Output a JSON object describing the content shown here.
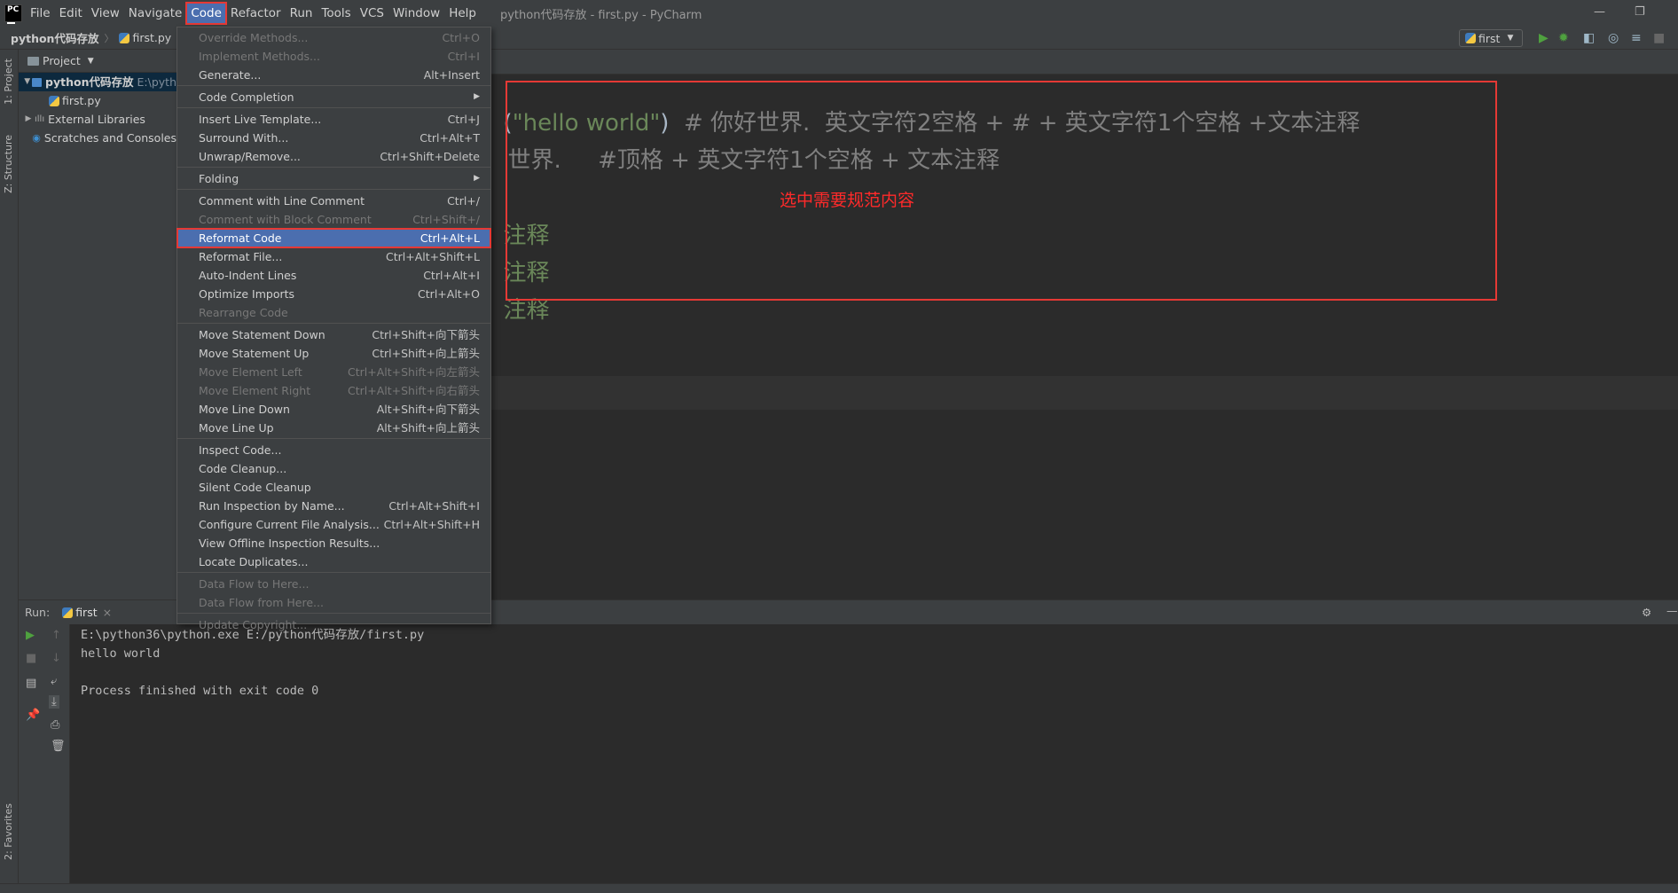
{
  "app": {
    "logo": "PC",
    "window_title": "python代码存放 - first.py - PyCharm"
  },
  "menubar": [
    "File",
    "Edit",
    "View",
    "Navigate",
    "Code",
    "Refactor",
    "Run",
    "Tools",
    "VCS",
    "Window",
    "Help"
  ],
  "menubar_active": "Code",
  "navbar": {
    "project": "python代码存放",
    "file": "first.py",
    "run_config": "first"
  },
  "left_strip": {
    "project_tab": "1: Project",
    "structure_tab": "Z: Structure",
    "favorites_tab": "2: Favorites"
  },
  "project_panel": {
    "title": "Project",
    "tree": [
      {
        "label": "python代码存放",
        "hint": "E:\\pyth",
        "type": "folder",
        "expanded": true,
        "selected": true
      },
      {
        "label": "first.py",
        "type": "python-file"
      },
      {
        "label": "External Libraries",
        "type": "library",
        "expanded": false
      },
      {
        "label": "Scratches and Consoles",
        "type": "scratch"
      }
    ]
  },
  "editor": {
    "line1_paren": "(",
    "line1_string": "\"hello world\"",
    "line1_close": ")",
    "line1_comment": "  # 你好世界.  英文字符2空格 + # + 英文字符1个空格 +文本注释",
    "line2": "世界.     #顶格 + 英文字符1个空格 + 文本注释",
    "line3": "注释",
    "line4": "注释",
    "line5": "注释",
    "annotation": "选中需要规范内容"
  },
  "code_menu": {
    "groups": [
      [
        {
          "label": "Override Methods...",
          "shortcut": "Ctrl+O",
          "disabled": true
        },
        {
          "label": "Implement Methods...",
          "shortcut": "Ctrl+I",
          "disabled": true
        },
        {
          "label": "Generate...",
          "shortcut": "Alt+Insert"
        }
      ],
      [
        {
          "label": "Code Completion",
          "shortcut": "",
          "submenu": true
        }
      ],
      [
        {
          "label": "Insert Live Template...",
          "shortcut": "Ctrl+J"
        },
        {
          "label": "Surround With...",
          "shortcut": "Ctrl+Alt+T"
        },
        {
          "label": "Unwrap/Remove...",
          "shortcut": "Ctrl+Shift+Delete"
        }
      ],
      [
        {
          "label": "Folding",
          "shortcut": "",
          "submenu": true
        }
      ],
      [
        {
          "label": "Comment with Line Comment",
          "shortcut": "Ctrl+/"
        },
        {
          "label": "Comment with Block Comment",
          "shortcut": "Ctrl+Shift+/",
          "disabled": true
        },
        {
          "label": "Reformat Code",
          "shortcut": "Ctrl+Alt+L",
          "highlight": true
        },
        {
          "label": "Reformat File...",
          "shortcut": "Ctrl+Alt+Shift+L"
        },
        {
          "label": "Auto-Indent Lines",
          "shortcut": "Ctrl+Alt+I"
        },
        {
          "label": "Optimize Imports",
          "shortcut": "Ctrl+Alt+O"
        },
        {
          "label": "Rearrange Code",
          "shortcut": "",
          "disabled": true
        }
      ],
      [
        {
          "label": "Move Statement Down",
          "shortcut": "Ctrl+Shift+向下箭头"
        },
        {
          "label": "Move Statement Up",
          "shortcut": "Ctrl+Shift+向上箭头"
        },
        {
          "label": "Move Element Left",
          "shortcut": "Ctrl+Alt+Shift+向左箭头",
          "disabled": true
        },
        {
          "label": "Move Element Right",
          "shortcut": "Ctrl+Alt+Shift+向右箭头",
          "disabled": true
        },
        {
          "label": "Move Line Down",
          "shortcut": "Alt+Shift+向下箭头"
        },
        {
          "label": "Move Line Up",
          "shortcut": "Alt+Shift+向上箭头"
        }
      ],
      [
        {
          "label": "Inspect Code...",
          "shortcut": ""
        },
        {
          "label": "Code Cleanup...",
          "shortcut": ""
        },
        {
          "label": "Silent Code Cleanup",
          "shortcut": ""
        },
        {
          "label": "Run Inspection by Name...",
          "shortcut": "Ctrl+Alt+Shift+I"
        },
        {
          "label": "Configure Current File Analysis...",
          "shortcut": "Ctrl+Alt+Shift+H"
        },
        {
          "label": "View Offline Inspection Results...",
          "shortcut": ""
        },
        {
          "label": "Locate Duplicates...",
          "shortcut": ""
        }
      ],
      [
        {
          "label": "Data Flow to Here...",
          "shortcut": "",
          "disabled": true
        },
        {
          "label": "Data Flow from Here...",
          "shortcut": "",
          "disabled": true
        }
      ],
      [
        {
          "label": "Update Copyright...",
          "shortcut": "",
          "disabled": true
        }
      ]
    ]
  },
  "run_panel": {
    "label": "Run:",
    "tab": "first",
    "console": [
      "E:\\python36\\python.exe E:/python代码存放/first.py",
      "hello world",
      "",
      "Process finished with exit code 0"
    ]
  },
  "colors": {
    "highlight": "#4b6eaf",
    "annotation_red": "#e53935",
    "string_green": "#6a8759",
    "comment_gray": "#808080"
  }
}
